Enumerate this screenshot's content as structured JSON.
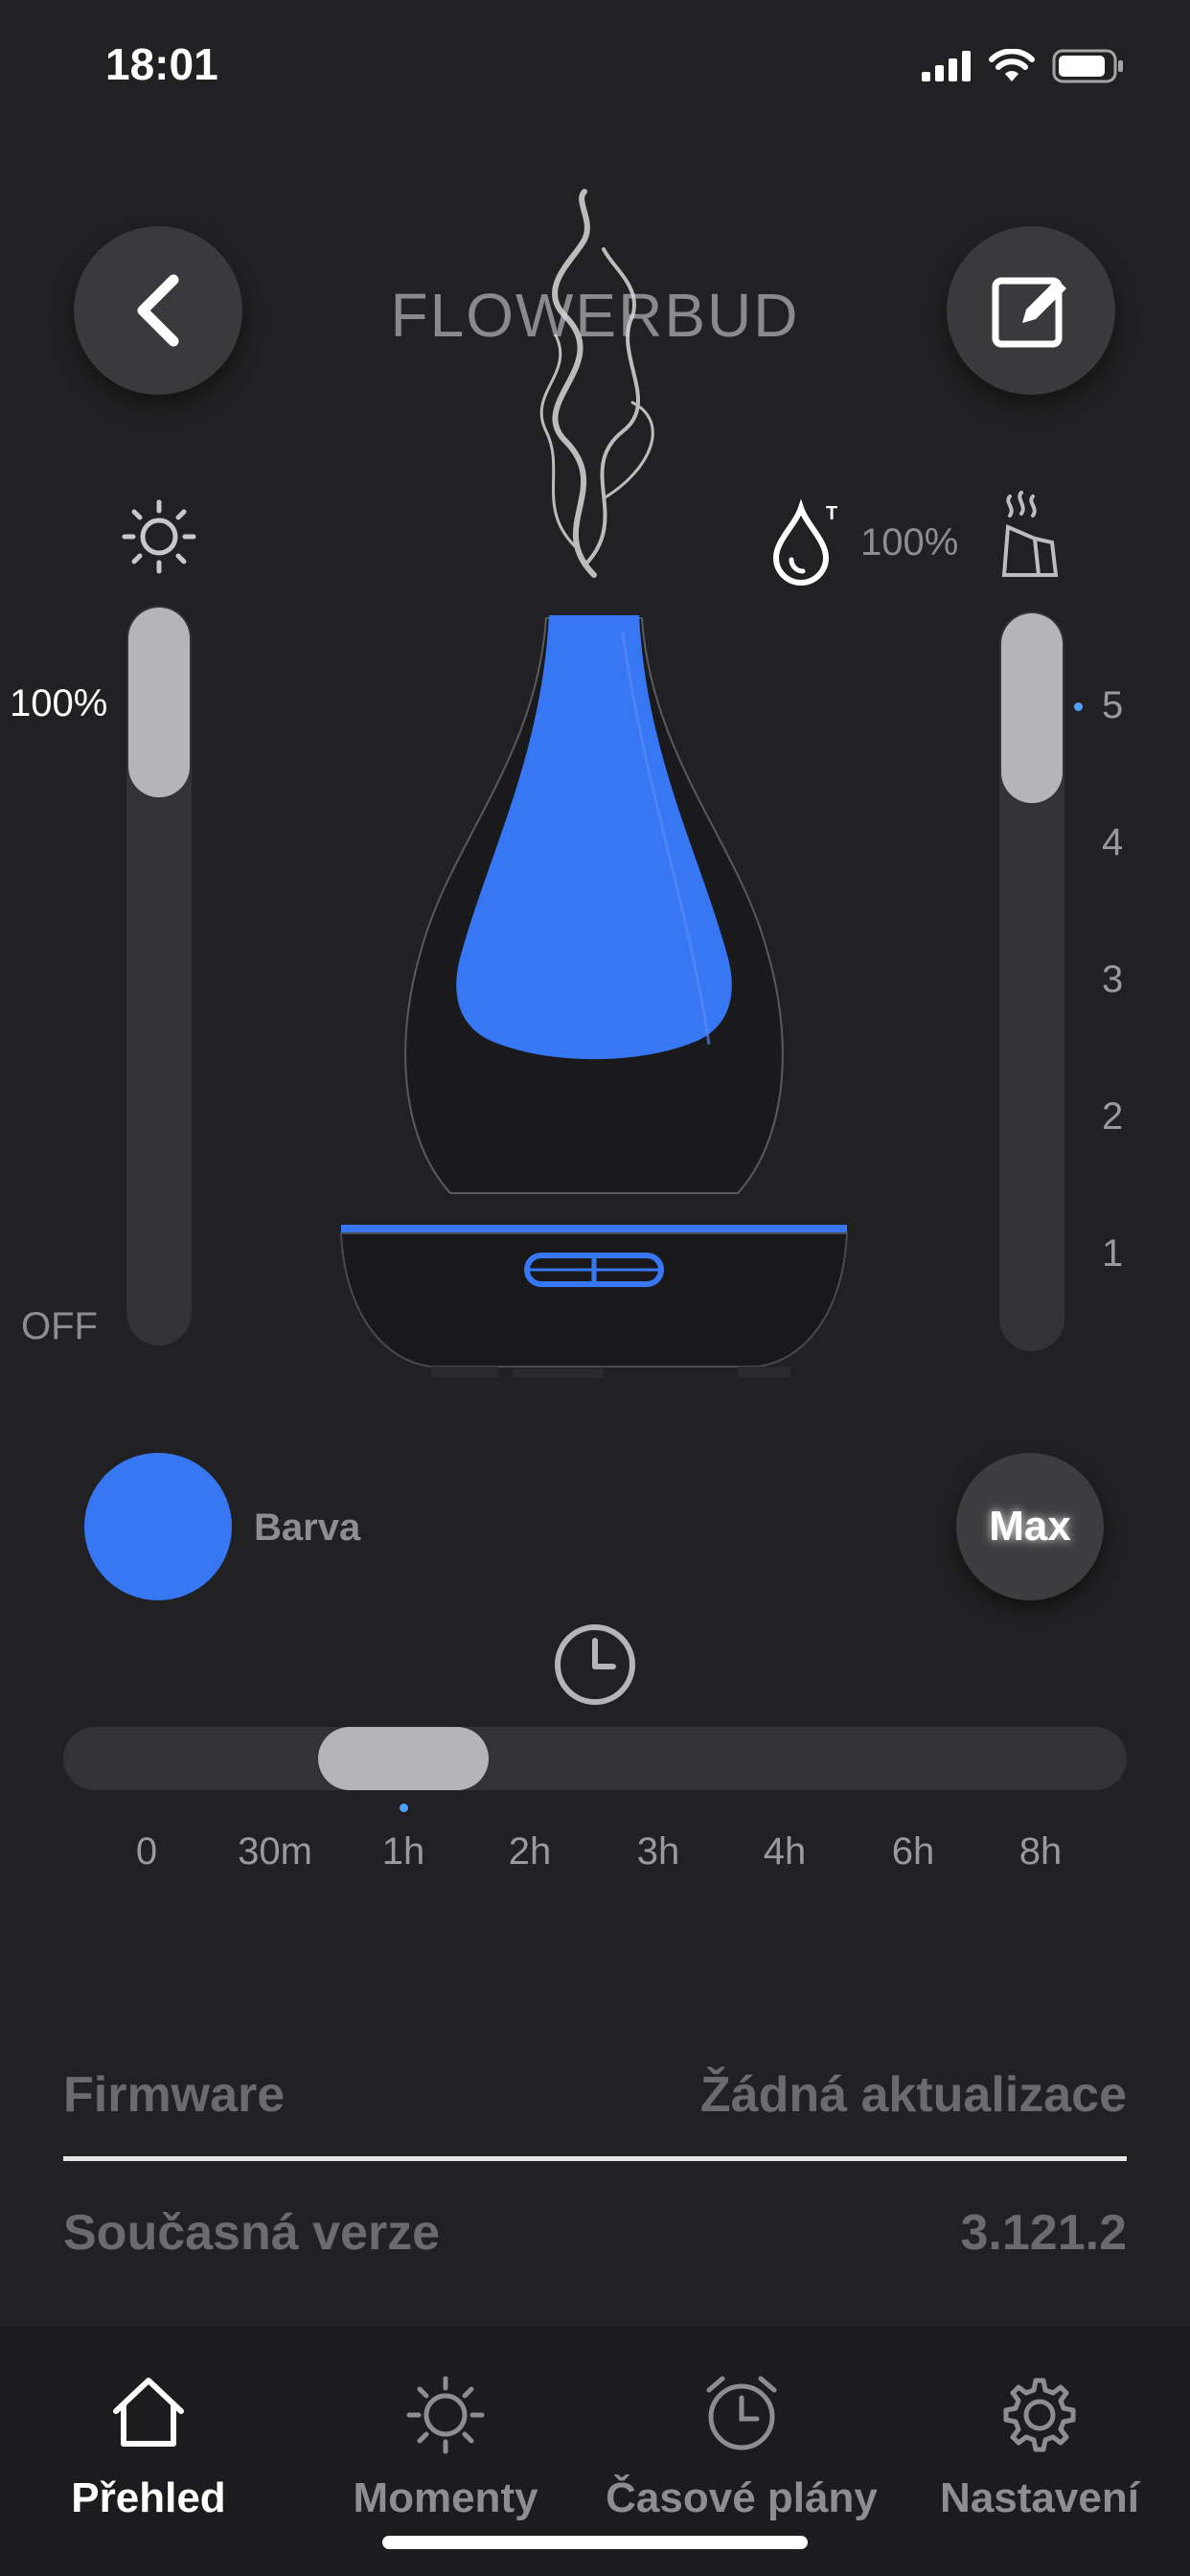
{
  "status_bar": {
    "time": "18:01"
  },
  "header": {
    "title": "FLOWERBUD"
  },
  "brightness": {
    "value_label": "100%",
    "off_label": "OFF",
    "level": 1.0
  },
  "water": {
    "value_label": "100%"
  },
  "mist": {
    "levels": [
      "5",
      "4",
      "3",
      "2",
      "1"
    ],
    "selected": "5"
  },
  "device": {
    "light_color": "#3777f4"
  },
  "color": {
    "label": "Barva",
    "value": "#3777f4"
  },
  "max_button": {
    "label": "Max"
  },
  "timer": {
    "ticks": [
      "0",
      "30m",
      "1h",
      "2h",
      "3h",
      "4h",
      "6h",
      "8h"
    ],
    "selected": "1h"
  },
  "firmware": {
    "label": "Firmware",
    "status": "Žádná aktualizace",
    "version_label": "Současná verze",
    "version": "3.121.2"
  },
  "tabs": [
    {
      "label": "Přehled",
      "icon": "home-icon",
      "active": true
    },
    {
      "label": "Momenty",
      "icon": "sun-icon",
      "active": false
    },
    {
      "label": "Časové plány",
      "icon": "alarm-clock-icon",
      "active": false
    },
    {
      "label": "Nastavení",
      "icon": "gear-icon",
      "active": false
    }
  ]
}
